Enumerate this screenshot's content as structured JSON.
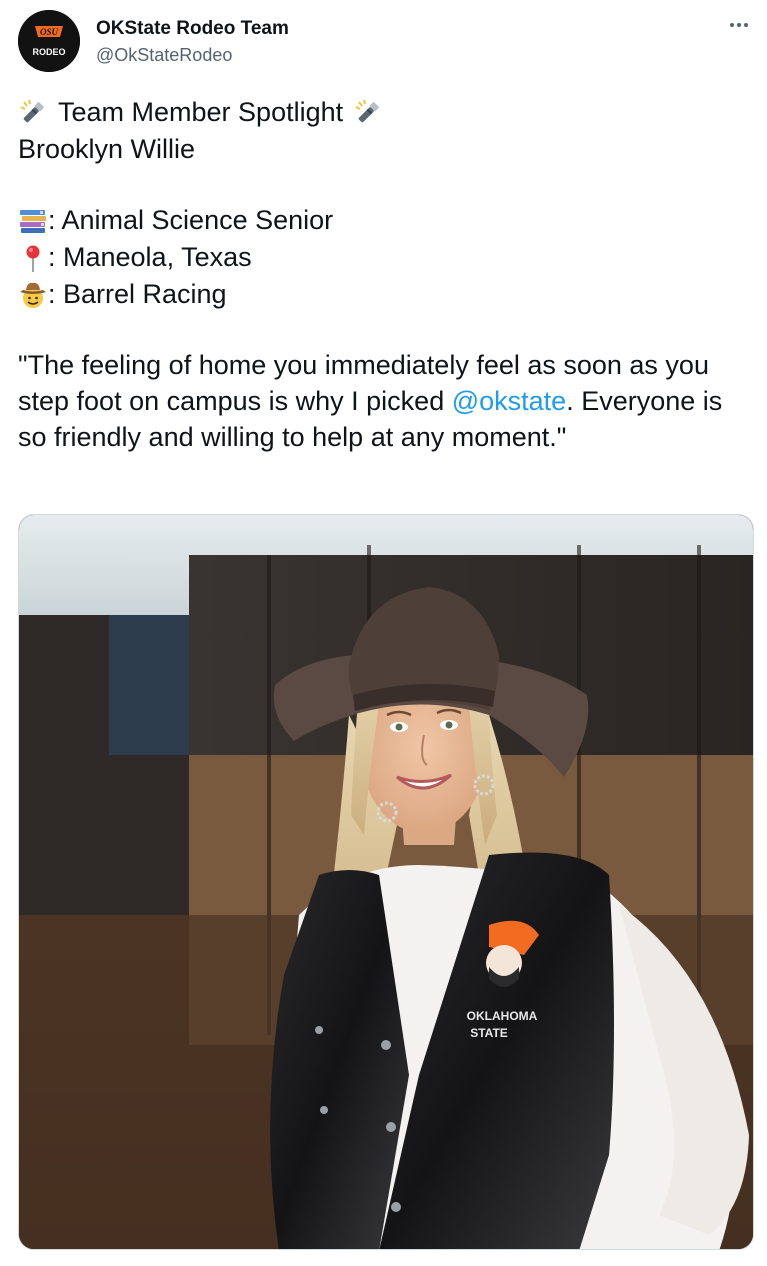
{
  "account": {
    "name": "OKState Rodeo Team",
    "handle": "@OkStateRodeo",
    "avatar_text": "RODEO",
    "avatar_icon": "osu-brand-icon"
  },
  "menu_icon": "more-options-icon",
  "tweet": {
    "headline": "Team Member Spotlight",
    "headline_icon": "flashlight-icon",
    "member_name": "Brooklyn Willie",
    "facts": [
      {
        "icon": "books-icon",
        "text": ": Animal Science Senior"
      },
      {
        "icon": "round-pushpin-icon",
        "text": ": Maneola, Texas"
      },
      {
        "icon": "cowboy-face-icon",
        "text": ": Barrel Racing"
      }
    ],
    "quote_before": "\"The feeling of home you immediately feel as soon as you step foot on campus is why I picked ",
    "mention": "@okstate",
    "quote_after": ". Everyone is so friendly and willing to help at any moment.\""
  },
  "photo": {
    "vest_text_line1": "OKLAHOMA",
    "vest_text_line2": "STATE"
  },
  "colors": {
    "link": "#1d9bf0",
    "text": "#0f1419",
    "secondary": "#536471",
    "osu_orange": "#f26b21"
  }
}
